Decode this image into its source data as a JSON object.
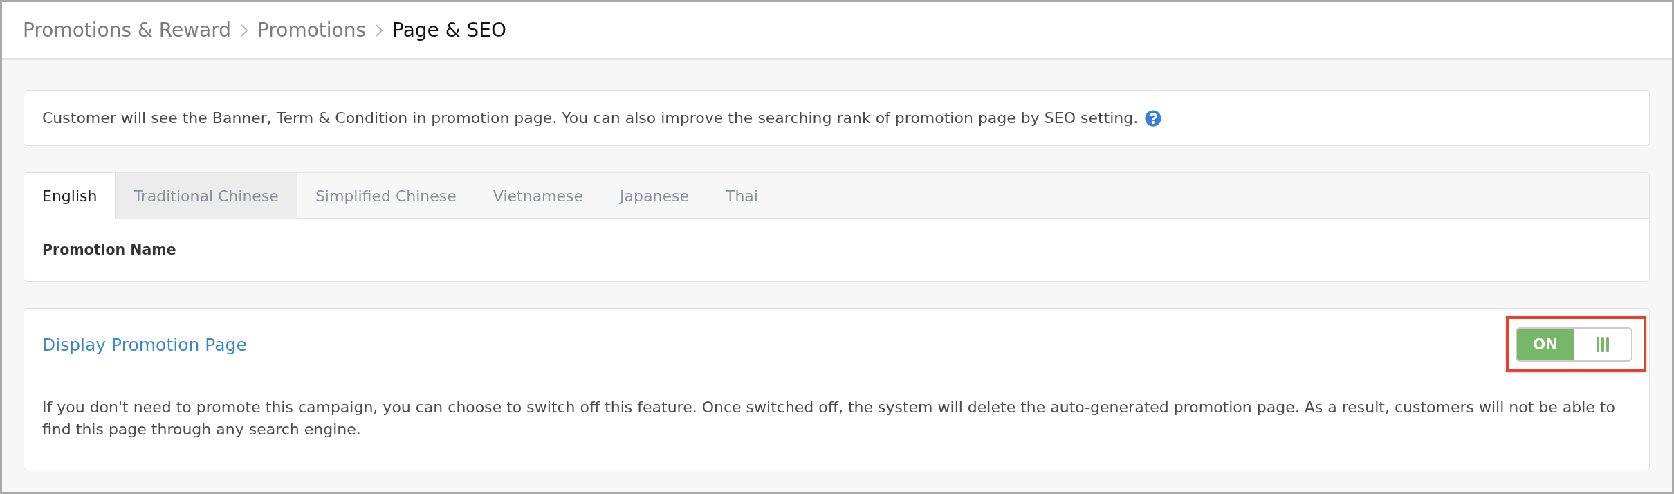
{
  "breadcrumb": [
    {
      "label": "Promotions & Reward",
      "current": false
    },
    {
      "label": "Promotions",
      "current": false
    },
    {
      "label": "Page & SEO",
      "current": true
    }
  ],
  "info": {
    "text": "Customer will see the Banner, Term & Condition in promotion page. You can also improve the searching rank of promotion page by SEO setting."
  },
  "tabs": [
    {
      "label": "English",
      "selected": true,
      "hovered": false
    },
    {
      "label": "Traditional Chinese",
      "selected": false,
      "hovered": true
    },
    {
      "label": "Simplified Chinese",
      "selected": false,
      "hovered": false
    },
    {
      "label": "Vietnamese",
      "selected": false,
      "hovered": false
    },
    {
      "label": "Japanese",
      "selected": false,
      "hovered": false
    },
    {
      "label": "Thai",
      "selected": false,
      "hovered": false
    }
  ],
  "tab_panel": {
    "field_label": "Promotion Name"
  },
  "display_section": {
    "title": "Display Promotion Page",
    "toggle": {
      "label": "ON",
      "on": true,
      "highlighted": true
    },
    "description": "If you don't need to promote this campaign, you can choose to switch off this feature. Once switched off, the system will delete the auto-generated promotion page. As a result, customers will not be able to find this page through any search engine."
  }
}
